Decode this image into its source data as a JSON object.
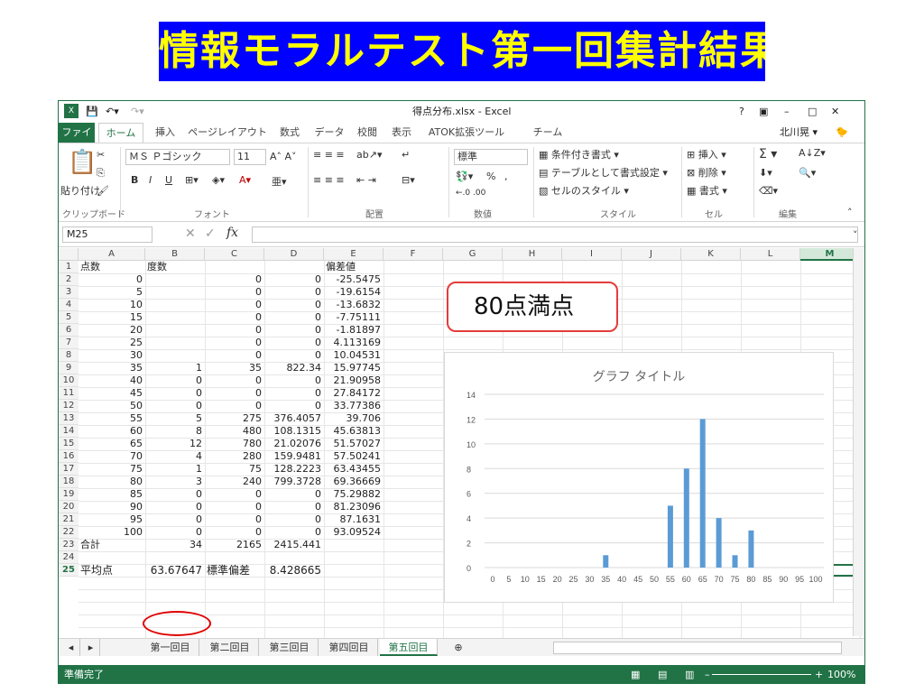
{
  "slide_title": "情報モラルテスト第一回集計結果",
  "callout": "80点満点",
  "window": {
    "title": "得点分布.xlsx - Excel",
    "help": "?",
    "user": "北川晃 ▾",
    "controls": [
      "–",
      "□",
      "✕"
    ]
  },
  "ribbon_tabs": [
    "ファイル",
    "ホーム",
    "挿入",
    "ページレイアウト",
    "数式",
    "データ",
    "校閲",
    "表示",
    "ATOK拡張ツール",
    "チーム"
  ],
  "ribbon": {
    "paste": "貼り付け",
    "font_name": "ＭＳ Ｐゴシック",
    "font_size": "11",
    "bold": "B",
    "italic": "I",
    "underline": "U",
    "number_format": "標準",
    "percent": "%",
    "comma": ",",
    "conditional": "条件付き書式 ▾",
    "table_format": "テーブルとして書式設定 ▾",
    "cell_style": "セルのスタイル ▾",
    "insert": "挿入 ▾",
    "delete": "削除 ▾",
    "format": "書式 ▾",
    "sum": "Σ ▾",
    "groups": [
      "クリップボード",
      "フォント",
      "配置",
      "数値",
      "スタイル",
      "セル",
      "編集"
    ]
  },
  "formula": {
    "name_box": "M25",
    "fx": "fx",
    "value": ""
  },
  "columns": [
    "A",
    "B",
    "C",
    "D",
    "E",
    "F",
    "G",
    "H",
    "I",
    "J",
    "K",
    "L",
    "M"
  ],
  "rows": [
    [
      "点数",
      "度数",
      "",
      "",
      "偏差値"
    ],
    [
      "0",
      "",
      "0",
      "0",
      "-25.5475"
    ],
    [
      "5",
      "",
      "0",
      "0",
      "-19.6154"
    ],
    [
      "10",
      "",
      "0",
      "0",
      "-13.6832"
    ],
    [
      "15",
      "",
      "0",
      "0",
      "-7.75111"
    ],
    [
      "20",
      "",
      "0",
      "0",
      "-1.81897"
    ],
    [
      "25",
      "",
      "0",
      "0",
      "4.113169"
    ],
    [
      "30",
      "",
      "0",
      "0",
      "10.04531"
    ],
    [
      "35",
      "1",
      "35",
      "822.34",
      "15.97745"
    ],
    [
      "40",
      "0",
      "0",
      "0",
      "21.90958"
    ],
    [
      "45",
      "0",
      "0",
      "0",
      "27.84172"
    ],
    [
      "50",
      "0",
      "0",
      "0",
      "33.77386"
    ],
    [
      "55",
      "5",
      "275",
      "376.4057",
      "39.706"
    ],
    [
      "60",
      "8",
      "480",
      "108.1315",
      "45.63813"
    ],
    [
      "65",
      "12",
      "780",
      "21.02076",
      "51.57027"
    ],
    [
      "70",
      "4",
      "280",
      "159.9481",
      "57.50241"
    ],
    [
      "75",
      "1",
      "75",
      "128.2223",
      "63.43455"
    ],
    [
      "80",
      "3",
      "240",
      "799.3728",
      "69.36669"
    ],
    [
      "85",
      "0",
      "0",
      "0",
      "75.29882"
    ],
    [
      "90",
      "0",
      "0",
      "0",
      "81.23096"
    ],
    [
      "95",
      "0",
      "0",
      "0",
      "87.1631"
    ],
    [
      "100",
      "0",
      "0",
      "0",
      "93.09524"
    ],
    [
      "合計",
      "34",
      "2165",
      "2415.441",
      ""
    ],
    [
      "",
      "",
      "",
      "",
      ""
    ],
    [
      "平均点",
      "63.67647",
      "標準偏差",
      "8.428665",
      ""
    ]
  ],
  "sheet_tabs": [
    "第一回目",
    "第二回目",
    "第三回目",
    "第四回目",
    "第五回目"
  ],
  "status": {
    "ready": "準備完了",
    "zoom": "100%"
  },
  "chart_data": {
    "type": "bar",
    "title": "グラフ タイトル",
    "categories": [
      "0",
      "5",
      "10",
      "15",
      "20",
      "25",
      "30",
      "35",
      "40",
      "45",
      "50",
      "55",
      "60",
      "65",
      "70",
      "75",
      "80",
      "85",
      "90",
      "95",
      "100"
    ],
    "values": [
      0,
      0,
      0,
      0,
      0,
      0,
      0,
      1,
      0,
      0,
      0,
      5,
      8,
      12,
      4,
      1,
      3,
      0,
      0,
      0,
      0
    ],
    "ylim": [
      0,
      14
    ],
    "yticks": [
      0,
      2,
      4,
      6,
      8,
      10,
      12,
      14
    ],
    "color": "#5b9bd5",
    "grid": true
  }
}
